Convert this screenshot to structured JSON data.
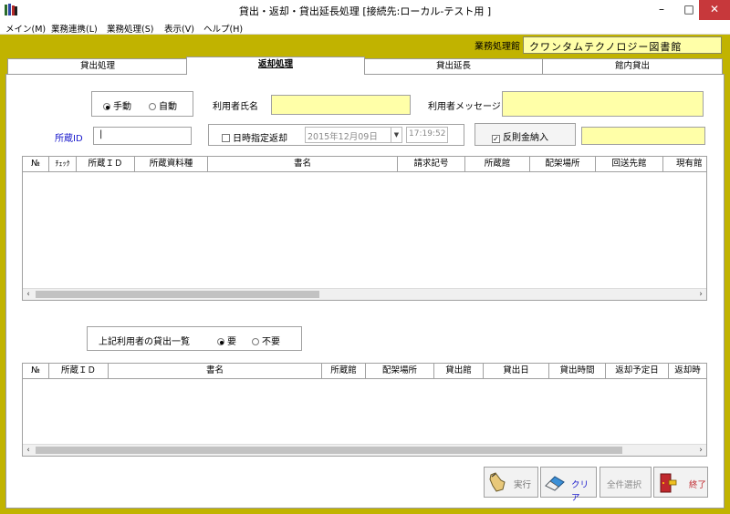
{
  "window": {
    "title": "貸出・返却・貸出延長処理 [接続先:ローカル-テスト用 ]",
    "min_icon": "minimize-icon",
    "max_icon": "maximize-icon",
    "close_icon": "close-icon"
  },
  "menu": [
    "メイン(M)",
    "業務連携(L)",
    "業務処理(S)",
    "表示(V)",
    "ヘルプ(H)"
  ],
  "branch": {
    "label": "業務処理館",
    "value": "クワンタムテクノロジー図書館"
  },
  "tabs": [
    "貸出処理",
    "返却処理",
    "貸出延長",
    "館内貸出"
  ],
  "active_tab": "返却処理",
  "form": {
    "mode_manual": "手動",
    "mode_auto": "自動",
    "user_name_label": "利用者氏名",
    "user_message_label": "利用者メッセージ",
    "holding_id_label": "所蔵ID",
    "holding_id_value": "|",
    "date_return_label": "日時指定返却",
    "date_value": "2015年12月09日",
    "time_value": "17:19:52",
    "penalty_label": "反則金納入"
  },
  "grid1": {
    "columns": [
      "№",
      "ﾁｪｯｸ",
      "所蔵ＩＤ",
      "所蔵資料種",
      "書名",
      "請求記号",
      "所蔵館",
      "配架場所",
      "回送先館",
      "現有館"
    ]
  },
  "loan_list": {
    "label": "上記利用者の貸出一覧",
    "required": "要",
    "not_required": "不要"
  },
  "grid2": {
    "columns": [
      "№",
      "所蔵ＩＤ",
      "書名",
      "所蔵館",
      "配架場所",
      "貸出館",
      "貸出日",
      "貸出時間",
      "返却予定日",
      "返却時"
    ]
  },
  "buttons": {
    "execute": "実行",
    "clear": "クリア",
    "select_all": "全件選択",
    "exit": "終了"
  },
  "colors": {
    "frame": "#c1b300",
    "input_yellow": "#ffffa8",
    "link_blue": "#1a1acc",
    "close_red": "#c7383b"
  }
}
